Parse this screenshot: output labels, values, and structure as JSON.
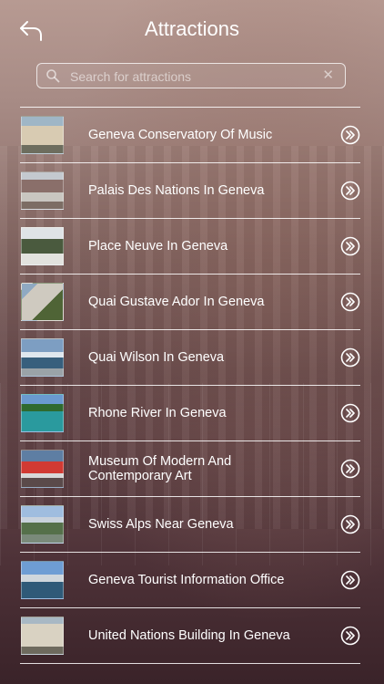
{
  "header": {
    "title": "Attractions",
    "back_icon": "back-arrow-icon"
  },
  "search": {
    "placeholder": "Search for attractions",
    "value": "",
    "clear_label": "✕"
  },
  "colors": {
    "background_top": "#b79a92",
    "background_bottom": "#3a2329",
    "text": "#ffffff",
    "divider": "#ffffff"
  },
  "list": {
    "items": [
      {
        "label": "Geneva Conservatory Of Music"
      },
      {
        "label": "Palais Des Nations In Geneva"
      },
      {
        "label": "Place Neuve In Geneva"
      },
      {
        "label": "Quai Gustave Ador In Geneva"
      },
      {
        "label": "Quai Wilson In Geneva"
      },
      {
        "label": "Rhone River In Geneva"
      },
      {
        "label": "Museum Of Modern And Contemporary Art"
      },
      {
        "label": "Swiss Alps Near Geneva"
      },
      {
        "label": "Geneva Tourist Information Office"
      },
      {
        "label": "United Nations Building In Geneva"
      }
    ],
    "row_icon": "double-chevron-right-icon"
  }
}
